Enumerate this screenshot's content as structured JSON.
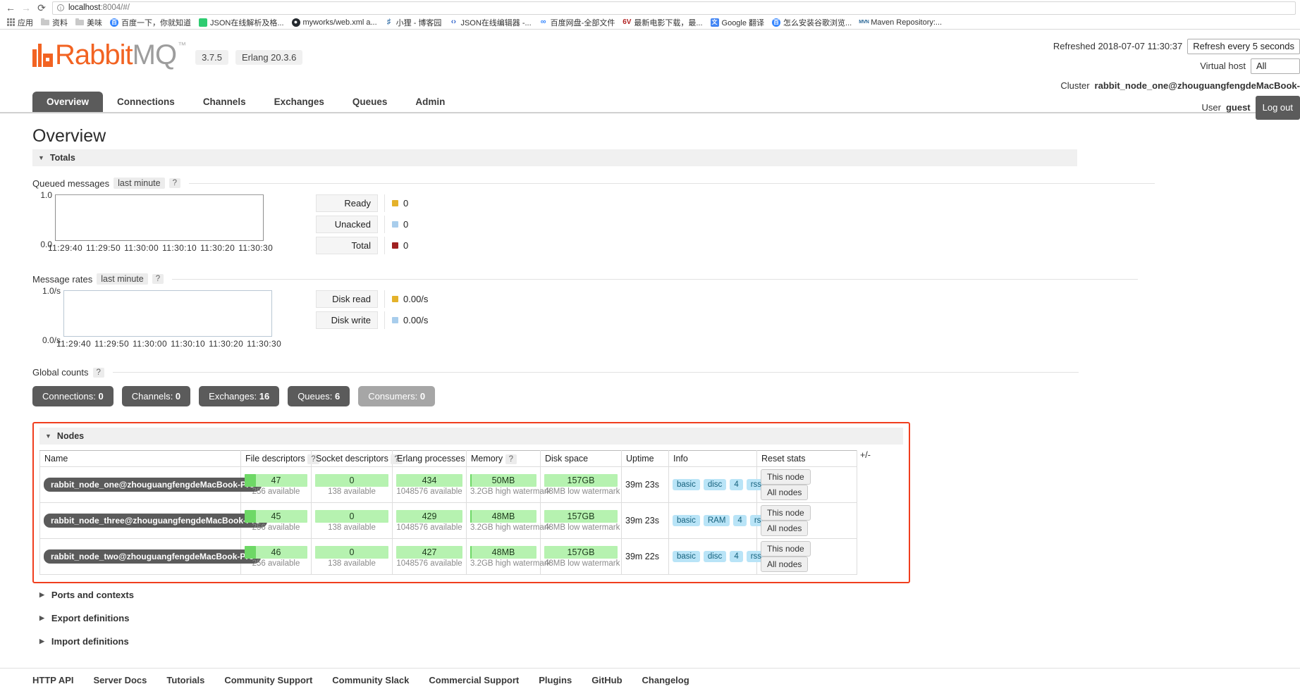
{
  "browser": {
    "back_icon": "back-arrow",
    "forward_icon": "forward-arrow",
    "reload_icon": "reload",
    "url_host": "localhost",
    "url_rest": ":8004/#/",
    "bookmarks": [
      {
        "label": "应用",
        "icon": "apps-grid-icon"
      },
      {
        "label": "资料",
        "icon": "folder-icon"
      },
      {
        "label": "美味",
        "icon": "folder-icon"
      },
      {
        "label": "百度一下，你就知道",
        "icon": "baidu-icon",
        "glyph": "百"
      },
      {
        "label": "JSON在线解析及格...",
        "icon": "json-icon",
        "glyph": ""
      },
      {
        "label": "myworks/web.xml a...",
        "icon": "github-icon",
        "glyph": "●"
      },
      {
        "label": "小狸 - 博客园",
        "icon": "cnblogs-icon",
        "glyph": "♉"
      },
      {
        "label": "JSON在线编辑器 -...",
        "icon": "json-editor-icon",
        "glyph": "‹›"
      },
      {
        "label": "百度网盘-全部文件",
        "icon": "baidu-pan-icon",
        "glyph": "♻"
      },
      {
        "label": "最新电影下载，最...",
        "icon": "sixv-icon",
        "glyph": "6V"
      },
      {
        "label": "Google 翻译",
        "icon": "google-translate-icon",
        "glyph": "文"
      },
      {
        "label": "怎么安装谷歌浏览...",
        "icon": "baidu-icon",
        "glyph": "百"
      },
      {
        "label": "Maven Repository:...",
        "icon": "maven-icon",
        "glyph": "MVN"
      }
    ]
  },
  "header": {
    "product": "RabbitMQ",
    "product_rabbit": "Rabbit",
    "product_mq": "MQ",
    "trademark": "™",
    "version": "3.7.5",
    "erlang": "Erlang 20.3.6",
    "refreshed_label": "Refreshed 2018-07-07 11:30:37",
    "refresh_select": "Refresh every 5 seconds",
    "vhost_label": "Virtual host",
    "vhost_value": "All",
    "cluster_label": "Cluster",
    "cluster_value": "rabbit_node_one@zhouguangfengdeMacBook-",
    "user_label": "User",
    "user_value": "guest",
    "logout_label": "Log out"
  },
  "nav": {
    "tabs": [
      {
        "label": "Overview",
        "active": true
      },
      {
        "label": "Connections",
        "active": false
      },
      {
        "label": "Channels",
        "active": false
      },
      {
        "label": "Exchanges",
        "active": false
      },
      {
        "label": "Queues",
        "active": false
      },
      {
        "label": "Admin",
        "active": false
      }
    ]
  },
  "page": {
    "title": "Overview",
    "totals_section": "Totals"
  },
  "chart_data": [
    {
      "type": "line",
      "title": "Queued messages",
      "period": "last minute",
      "help": "?",
      "xlabel": "",
      "ylabel": "",
      "ylim": [
        0.0,
        1.0
      ],
      "ytick_labels": [
        "1.0",
        "0.0"
      ],
      "x": [
        "11:29:40",
        "11:29:50",
        "11:30:00",
        "11:30:10",
        "11:30:20",
        "11:30:30"
      ],
      "series": [
        {
          "name": "Ready",
          "value": "0",
          "color": "#e4b22b",
          "values": [
            0,
            0,
            0,
            0,
            0,
            0
          ]
        },
        {
          "name": "Unacked",
          "value": "0",
          "color": "#a8cdec",
          "values": [
            0,
            0,
            0,
            0,
            0,
            0
          ]
        },
        {
          "name": "Total",
          "value": "0",
          "color": "#a02020",
          "values": [
            0,
            0,
            0,
            0,
            0,
            0
          ]
        }
      ],
      "grid": false,
      "legend": "right"
    },
    {
      "type": "line",
      "title": "Message rates",
      "period": "last minute",
      "help": "?",
      "xlabel": "",
      "ylabel": "",
      "ylim": [
        0.0,
        1.0
      ],
      "ytick_labels": [
        "1.0/s",
        "0.0/s"
      ],
      "x": [
        "11:29:40",
        "11:29:50",
        "11:30:00",
        "11:30:10",
        "11:30:20",
        "11:30:30"
      ],
      "series": [
        {
          "name": "Disk read",
          "value": "0.00/s",
          "color": "#e4b22b",
          "values": [
            0,
            0,
            0,
            0,
            0,
            0
          ]
        },
        {
          "name": "Disk write",
          "value": "0.00/s",
          "color": "#a8cdec",
          "values": [
            0,
            0,
            0,
            0,
            0,
            0
          ]
        }
      ],
      "grid": false,
      "legend": "right"
    }
  ],
  "global_counts": {
    "label": "Global counts",
    "help": "?",
    "items": [
      {
        "name": "Connections",
        "value": "0",
        "muted": false
      },
      {
        "name": "Channels",
        "value": "0",
        "muted": false
      },
      {
        "name": "Exchanges",
        "value": "16",
        "muted": false
      },
      {
        "name": "Queues",
        "value": "6",
        "muted": false
      },
      {
        "name": "Consumers",
        "value": "0",
        "muted": true
      }
    ]
  },
  "nodes": {
    "section_label": "Nodes",
    "columns": [
      "Name",
      "File descriptors",
      "Socket descriptors",
      "Erlang processes",
      "Memory",
      "Disk space",
      "Uptime",
      "Info",
      "Reset stats"
    ],
    "col_help": {
      "file_descriptors": "?",
      "socket_descriptors": "?",
      "memory": "?"
    },
    "plus_minus": "+/-",
    "rows": [
      {
        "name": "rabbit_node_one@zhouguangfengdeMacBook-Pro",
        "fd_value": "47",
        "fd_sub": "256 available",
        "fd_pct": 18,
        "sd_value": "0",
        "sd_sub": "138 available",
        "sd_pct": 0,
        "proc_value": "434",
        "proc_sub": "1048576 available",
        "proc_pct": 0,
        "mem_value": "50MB",
        "mem_sub": "3.2GB high watermark",
        "mem_pct": 2,
        "disk_value": "157GB",
        "disk_sub": "48MB low watermark",
        "disk_pct": 100,
        "uptime": "39m 23s",
        "info": [
          "basic",
          "disc",
          "4",
          "rss"
        ],
        "reset": [
          "This node",
          "All nodes"
        ]
      },
      {
        "name": "rabbit_node_three@zhouguangfengdeMacBook-Pro",
        "fd_value": "45",
        "fd_sub": "256 available",
        "fd_pct": 18,
        "sd_value": "0",
        "sd_sub": "138 available",
        "sd_pct": 0,
        "proc_value": "429",
        "proc_sub": "1048576 available",
        "proc_pct": 0,
        "mem_value": "48MB",
        "mem_sub": "3.2GB high watermark",
        "mem_pct": 2,
        "disk_value": "157GB",
        "disk_sub": "48MB low watermark",
        "disk_pct": 100,
        "uptime": "39m 23s",
        "info": [
          "basic",
          "RAM",
          "4",
          "rss"
        ],
        "reset": [
          "This node",
          "All nodes"
        ]
      },
      {
        "name": "rabbit_node_two@zhouguangfengdeMacBook-Pro",
        "fd_value": "46",
        "fd_sub": "256 available",
        "fd_pct": 18,
        "sd_value": "0",
        "sd_sub": "138 available",
        "sd_pct": 0,
        "proc_value": "427",
        "proc_sub": "1048576 available",
        "proc_pct": 0,
        "mem_value": "48MB",
        "mem_sub": "3.2GB high watermark",
        "mem_pct": 2,
        "disk_value": "157GB",
        "disk_sub": "48MB low watermark",
        "disk_pct": 100,
        "uptime": "39m 22s",
        "info": [
          "basic",
          "disc",
          "4",
          "rss"
        ],
        "reset": [
          "This node",
          "All nodes"
        ]
      }
    ]
  },
  "sections": [
    {
      "label": "Ports and contexts"
    },
    {
      "label": "Export definitions"
    },
    {
      "label": "Import definitions"
    }
  ],
  "footer": {
    "links": [
      "HTTP API",
      "Server Docs",
      "Tutorials",
      "Community Support",
      "Community Slack",
      "Commercial Support",
      "Plugins",
      "GitHub",
      "Changelog"
    ]
  },
  "colors": {
    "brand_orange": "#f26322",
    "highlight_red": "#f03e1e",
    "gauge_green": "#6ed866",
    "gauge_bg": "#b6f2b0",
    "tag_blue": "#b9e4f7",
    "dark": "#5b5b5b"
  }
}
